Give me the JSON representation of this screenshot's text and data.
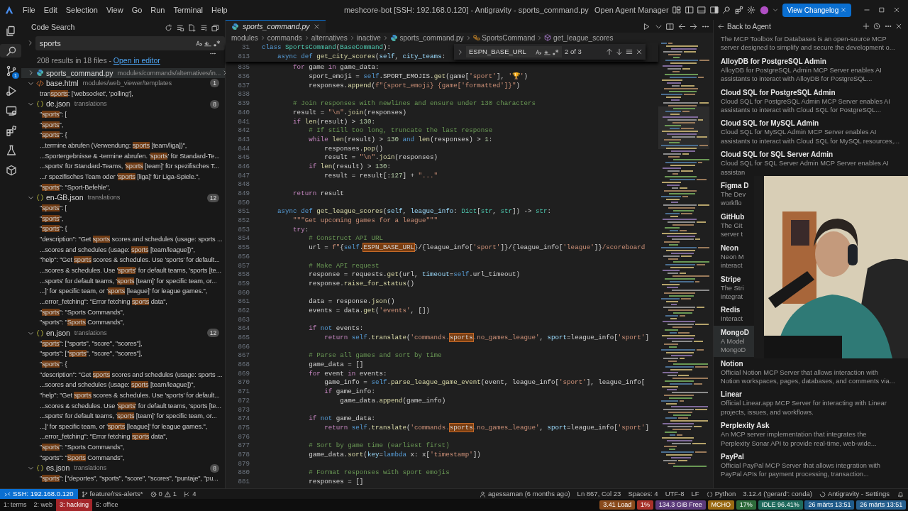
{
  "title_bar": {
    "menu": [
      "File",
      "Edit",
      "Selection",
      "View",
      "Go",
      "Run",
      "Terminal",
      "Help"
    ],
    "title": "meshcore-bot [SSH: 192.168.0.120] - Antigravity - sports_command.py",
    "agent_manager": "Open Agent Manager",
    "changelog_button": "View Changelog"
  },
  "activity_bar": {
    "items": [
      {
        "kind": "files",
        "selected": false
      },
      {
        "kind": "search",
        "selected": true
      },
      {
        "kind": "source-control",
        "selected": false,
        "badge": "1"
      },
      {
        "kind": "run",
        "selected": false
      },
      {
        "kind": "remote",
        "selected": false
      },
      {
        "kind": "extensions",
        "selected": false
      },
      {
        "kind": "testing",
        "selected": false
      },
      {
        "kind": "box",
        "selected": false
      }
    ]
  },
  "sidebar": {
    "title": "Code Search",
    "search": {
      "value": "sports"
    },
    "summary": "208 results in 18 files - ",
    "summary_link": "Open in editor",
    "files": [
      {
        "kind": "python",
        "name": "sports_command.py",
        "path": "modules/commands/alternatives/in...",
        "expanded": false,
        "selected": true
      },
      {
        "kind": "html",
        "name": "base.html",
        "path": "modules/web_viewer/templates",
        "count": "1",
        "expanded": true,
        "selected": false,
        "matches": [
          [
            "tran",
            "sports",
            ": ['websocket', 'polling'],"
          ]
        ]
      },
      {
        "kind": "json",
        "name": "de.json",
        "path": "translations",
        "count": "8",
        "expanded": true,
        "selected": false,
        "matches": [
          [
            "\"",
            "sports",
            "\": ["
          ],
          [
            "\"",
            "sports",
            "\","
          ],
          [
            "\"",
            "sports",
            "\": {"
          ],
          [
            "...termine abrufen (Verwendung: ",
            "sports",
            " [team/liga])\","
          ],
          [
            "...Sportergebnisse & -termine abrufen. '",
            "sports",
            "' für Standard-Te..."
          ],
          [
            "...sports' für Standard-Teams, '",
            "sports",
            " [team]' für spezifisches T..."
          ],
          [
            "...r spezifisches Team oder '",
            "sports",
            " [liga]' für Liga-Spiele.\","
          ],
          [
            "\"",
            "sports",
            "\": \"Sport-Befehle\","
          ]
        ]
      },
      {
        "kind": "json",
        "name": "en-GB.json",
        "path": "translations",
        "count": "12",
        "expanded": true,
        "selected": false,
        "matches": [
          [
            "\"",
            "sports",
            "\": ["
          ],
          [
            "\"",
            "sports",
            "\","
          ],
          [
            "\"",
            "sports",
            "\": {"
          ],
          [
            "\"description\": \"Get ",
            "sports",
            " scores and schedules (usage: sports ..."
          ],
          [
            "...scores and schedules (usage: ",
            "sports",
            " [team/league])\","
          ],
          [
            "\"help\": \"Get ",
            "sports",
            " scores & schedules. Use 'sports' for default..."
          ],
          [
            "...scores & schedules. Use '",
            "sports",
            "' for default teams, 'sports [te..."
          ],
          [
            "...sports' for default teams, '",
            "sports",
            " [team]' for specific team, or..."
          ],
          [
            "...]' for specific team, or '",
            "sports",
            " [league]' for league games.\","
          ],
          [
            "...error_fetching\": \"Error fetching ",
            "sports",
            " data\","
          ],
          [
            "\"",
            "sports",
            "\": \"Sports Commands\","
          ],
          [
            "\"sports\": \"",
            "Sports",
            " Commands\","
          ]
        ]
      },
      {
        "kind": "json",
        "name": "en.json",
        "path": "translations",
        "count": "12",
        "expanded": true,
        "selected": false,
        "matches": [
          [
            "\"",
            "sports",
            "\": [\"sports\", \"score\", \"scores\"],"
          ],
          [
            "\"sports\": [\"",
            "sports",
            "\", \"score\", \"scores\"],"
          ],
          [
            "\"",
            "sports",
            "\": {"
          ],
          [
            "\"description\": \"Get ",
            "sports",
            " scores and schedules (usage: sports ..."
          ],
          [
            "...scores and schedules (usage: ",
            "sports",
            " [team/league])\","
          ],
          [
            "\"help\": \"Get ",
            "sports",
            " scores & schedules. Use 'sports' for default..."
          ],
          [
            "...scores & schedules. Use '",
            "sports",
            "' for default teams, 'sports [te..."
          ],
          [
            "...sports' for default teams, '",
            "sports",
            " [team]' for specific team, or..."
          ],
          [
            "...]' for specific team, or '",
            "sports",
            " [league]' for league games.\","
          ],
          [
            "...error_fetching\": \"Error fetching ",
            "sports",
            " data\","
          ],
          [
            "\"",
            "sports",
            "\": \"Sports Commands\","
          ],
          [
            "\"sports\": \"",
            "Sports",
            " Commands\","
          ]
        ]
      },
      {
        "kind": "json",
        "name": "es.json",
        "path": "translations",
        "count": "8",
        "expanded": true,
        "selected": false,
        "matches": [
          [
            "\"",
            "sports",
            "\": [\"deportes\", \"sports\", \"score\", \"scores\", \"puntaje\", \"pu..."
          ]
        ]
      }
    ]
  },
  "editor": {
    "tab": {
      "label": "sports_command.py",
      "selected": true
    },
    "breadcrumb": [
      {
        "kind": "folder",
        "label": "modules"
      },
      {
        "kind": "folder",
        "label": "commands"
      },
      {
        "kind": "folder",
        "label": "alternatives"
      },
      {
        "kind": "folder",
        "label": "inactive"
      },
      {
        "kind": "file",
        "label": "sports_command.py"
      },
      {
        "kind": "class",
        "label": "SportsCommand"
      },
      {
        "kind": "method",
        "label": "get_league_scores"
      }
    ],
    "find": {
      "value": "ESPN_BASE_URL",
      "result": "2 of 3"
    },
    "sticky": [
      {
        "n": "31",
        "code": [
          {
            "kind": "k",
            "text": "class"
          },
          {
            "kind": "t",
            "text": " SportsCommand"
          },
          {
            "kind": "p",
            "text": "("
          },
          {
            "kind": "t",
            "text": "BaseCommand"
          },
          {
            "kind": "p",
            "text": "):"
          }
        ]
      },
      {
        "n": "813",
        "code": [
          {
            "kind": "k",
            "text": "    async"
          },
          {
            "kind": "k",
            "text": " def"
          },
          {
            "kind": "f",
            "text": " get_city_scores"
          },
          {
            "kind": "p",
            "text": "("
          },
          {
            "kind": "v",
            "text": "self"
          },
          {
            "kind": "p",
            "text": ", "
          },
          {
            "kind": "v",
            "text": "city_teams"
          },
          {
            "kind": "p",
            "text": ":"
          }
        ]
      }
    ],
    "lines": [
      {
        "n": "835",
        "code": [
          {
            "kind": "c",
            "text": "        for"
          },
          {
            "kind": "p",
            "text": " game "
          },
          {
            "kind": "c",
            "text": "in"
          },
          {
            "kind": "p",
            "text": " game_data:"
          }
        ]
      },
      {
        "n": "836",
        "code": [
          {
            "kind": "p",
            "text": "            sport_emoji = "
          },
          {
            "kind": "k",
            "text": "self"
          },
          {
            "kind": "p",
            "text": ".SPORT_EMOJIS."
          },
          {
            "kind": "f",
            "text": "get"
          },
          {
            "kind": "p",
            "text": "(game["
          },
          {
            "kind": "s",
            "text": "'sport'"
          },
          {
            "kind": "p",
            "text": "], "
          },
          {
            "kind": "s",
            "text": "'🏆'"
          },
          {
            "kind": "p",
            "text": ")"
          }
        ]
      },
      {
        "n": "837",
        "code": [
          {
            "kind": "p",
            "text": "            responses."
          },
          {
            "kind": "f",
            "text": "append"
          },
          {
            "kind": "p",
            "text": "("
          },
          {
            "kind": "s",
            "text": "f\"{sport_emoji} {game['formatted']}\""
          },
          {
            "kind": "p",
            "text": ")"
          }
        ]
      },
      {
        "n": "838"
      },
      {
        "n": "839",
        "code": [
          {
            "kind": "m",
            "text": "        # Join responses with newlines and ensure under 130 characters"
          }
        ]
      },
      {
        "n": "840",
        "code": [
          {
            "kind": "p",
            "text": "        result = "
          },
          {
            "kind": "s",
            "text": "\"\\n\""
          },
          {
            "kind": "p",
            "text": "."
          },
          {
            "kind": "f",
            "text": "join"
          },
          {
            "kind": "p",
            "text": "(responses)"
          }
        ]
      },
      {
        "n": "841",
        "code": [
          {
            "kind": "c",
            "text": "        if"
          },
          {
            "kind": "f",
            "text": " len"
          },
          {
            "kind": "p",
            "text": "(result) > "
          },
          {
            "kind": "n",
            "text": "130"
          },
          {
            "kind": "p",
            "text": ":"
          }
        ]
      },
      {
        "n": "842",
        "code": [
          {
            "kind": "m",
            "text": "            # If still too long, truncate the last response"
          }
        ]
      },
      {
        "n": "843",
        "code": [
          {
            "kind": "c",
            "text": "            while"
          },
          {
            "kind": "f",
            "text": " len"
          },
          {
            "kind": "p",
            "text": "(result) > "
          },
          {
            "kind": "n",
            "text": "130"
          },
          {
            "kind": "k",
            "text": " and"
          },
          {
            "kind": "f",
            "text": " len"
          },
          {
            "kind": "p",
            "text": "(responses) > "
          },
          {
            "kind": "n",
            "text": "1"
          },
          {
            "kind": "p",
            "text": ":"
          }
        ]
      },
      {
        "n": "844",
        "code": [
          {
            "kind": "p",
            "text": "                responses."
          },
          {
            "kind": "f",
            "text": "pop"
          },
          {
            "kind": "p",
            "text": "()"
          }
        ]
      },
      {
        "n": "845",
        "code": [
          {
            "kind": "p",
            "text": "                result = "
          },
          {
            "kind": "s",
            "text": "\"\\n\""
          },
          {
            "kind": "p",
            "text": "."
          },
          {
            "kind": "f",
            "text": "join"
          },
          {
            "kind": "p",
            "text": "(responses)"
          }
        ]
      },
      {
        "n": "846",
        "code": [
          {
            "kind": "c",
            "text": "            if"
          },
          {
            "kind": "f",
            "text": " len"
          },
          {
            "kind": "p",
            "text": "(result) > "
          },
          {
            "kind": "n",
            "text": "130"
          },
          {
            "kind": "p",
            "text": ":"
          }
        ]
      },
      {
        "n": "847",
        "code": [
          {
            "kind": "p",
            "text": "                result = result[:"
          },
          {
            "kind": "n",
            "text": "127"
          },
          {
            "kind": "p",
            "text": "] + "
          },
          {
            "kind": "s",
            "text": "\"...\""
          }
        ]
      },
      {
        "n": "848"
      },
      {
        "n": "849",
        "code": [
          {
            "kind": "c",
            "text": "        return"
          },
          {
            "kind": "p",
            "text": " result"
          }
        ]
      },
      {
        "n": "850"
      },
      {
        "n": "851",
        "code": [
          {
            "kind": "k",
            "text": "    async"
          },
          {
            "kind": "k",
            "text": " def"
          },
          {
            "kind": "f",
            "text": " get_league_scores"
          },
          {
            "kind": "p",
            "text": "("
          },
          {
            "kind": "v",
            "text": "self"
          },
          {
            "kind": "p",
            "text": ", "
          },
          {
            "kind": "v",
            "text": "league_info"
          },
          {
            "kind": "p",
            "text": ": "
          },
          {
            "kind": "t",
            "text": "Dict"
          },
          {
            "kind": "p",
            "text": "["
          },
          {
            "kind": "t",
            "text": "str"
          },
          {
            "kind": "p",
            "text": ", "
          },
          {
            "kind": "t",
            "text": "str"
          },
          {
            "kind": "p",
            "text": "]) -> "
          },
          {
            "kind": "t",
            "text": "str"
          },
          {
            "kind": "p",
            "text": ":"
          }
        ]
      },
      {
        "n": "852",
        "code": [
          {
            "kind": "s",
            "text": "        \"\"\"Get upcoming games for a league\"\"\""
          }
        ]
      },
      {
        "n": "853",
        "code": [
          {
            "kind": "c",
            "text": "        try"
          },
          {
            "kind": "p",
            "text": ":"
          }
        ]
      },
      {
        "n": "854",
        "code": [
          {
            "kind": "m",
            "text": "            # Construct API URL"
          }
        ]
      },
      {
        "n": "855",
        "code": [
          {
            "kind": "p",
            "text": "            url = "
          },
          {
            "kind": "s",
            "text": "f\""
          },
          {
            "kind": "p",
            "text": "{"
          },
          {
            "kind": "k",
            "text": "self"
          },
          {
            "kind": "p",
            "text": "."
          },
          {
            "kind": "h",
            "text": "ESPN_BASE_URL"
          },
          {
            "kind": "p",
            "text": "}/{league_info["
          },
          {
            "kind": "s",
            "text": "'sport'"
          },
          {
            "kind": "p",
            "text": "]}/{league_info["
          },
          {
            "kind": "s",
            "text": "'league'"
          },
          {
            "kind": "p",
            "text": "]}"
          },
          {
            "kind": "s",
            "text": "/scoreboard"
          }
        ]
      },
      {
        "n": "856"
      },
      {
        "n": "857",
        "code": [
          {
            "kind": "m",
            "text": "            # Make API request"
          }
        ]
      },
      {
        "n": "858",
        "code": [
          {
            "kind": "p",
            "text": "            response = requests."
          },
          {
            "kind": "f",
            "text": "get"
          },
          {
            "kind": "p",
            "text": "(url, "
          },
          {
            "kind": "v",
            "text": "timeout"
          },
          {
            "kind": "p",
            "text": "="
          },
          {
            "kind": "k",
            "text": "self"
          },
          {
            "kind": "p",
            "text": ".url_timeout)"
          }
        ]
      },
      {
        "n": "859",
        "code": [
          {
            "kind": "p",
            "text": "            response."
          },
          {
            "kind": "f",
            "text": "raise_for_status"
          },
          {
            "kind": "p",
            "text": "()"
          }
        ]
      },
      {
        "n": "860"
      },
      {
        "n": "861",
        "code": [
          {
            "kind": "p",
            "text": "            data = response."
          },
          {
            "kind": "f",
            "text": "json"
          },
          {
            "kind": "p",
            "text": "()"
          }
        ]
      },
      {
        "n": "862",
        "code": [
          {
            "kind": "p",
            "text": "            events = data."
          },
          {
            "kind": "f",
            "text": "get"
          },
          {
            "kind": "p",
            "text": "("
          },
          {
            "kind": "s",
            "text": "'events'"
          },
          {
            "kind": "p",
            "text": ", [])"
          }
        ]
      },
      {
        "n": "863"
      },
      {
        "n": "864",
        "code": [
          {
            "kind": "c",
            "text": "            if"
          },
          {
            "kind": "k",
            "text": " not"
          },
          {
            "kind": "p",
            "text": " events:"
          }
        ]
      },
      {
        "n": "865",
        "code": [
          {
            "kind": "c",
            "text": "                return"
          },
          {
            "kind": "k",
            "text": " self"
          },
          {
            "kind": "p",
            "text": "."
          },
          {
            "kind": "f",
            "text": "translate"
          },
          {
            "kind": "p",
            "text": "("
          },
          {
            "kind": "s",
            "text": "'commands."
          },
          {
            "kind": "h",
            "text": "sports"
          },
          {
            "kind": "s",
            "text": ".no_games_league'"
          },
          {
            "kind": "p",
            "text": ", "
          },
          {
            "kind": "v",
            "text": "sport"
          },
          {
            "kind": "p",
            "text": "=league_info["
          },
          {
            "kind": "s",
            "text": "'sport'"
          },
          {
            "kind": "p",
            "text": "]"
          }
        ]
      },
      {
        "n": "866"
      },
      {
        "n": "867",
        "code": [
          {
            "kind": "m",
            "text": "            # Parse all games and sort by time"
          }
        ]
      },
      {
        "n": "868",
        "code": [
          {
            "kind": "p",
            "text": "            game_data = []"
          }
        ]
      },
      {
        "n": "869",
        "code": [
          {
            "kind": "c",
            "text": "            for"
          },
          {
            "kind": "p",
            "text": " event "
          },
          {
            "kind": "c",
            "text": "in"
          },
          {
            "kind": "p",
            "text": " events:"
          }
        ]
      },
      {
        "n": "870",
        "code": [
          {
            "kind": "p",
            "text": "                game_info = "
          },
          {
            "kind": "k",
            "text": "self"
          },
          {
            "kind": "p",
            "text": "."
          },
          {
            "kind": "f",
            "text": "parse_league_game_event"
          },
          {
            "kind": "p",
            "text": "(event, league_info["
          },
          {
            "kind": "s",
            "text": "'sport'"
          },
          {
            "kind": "p",
            "text": "], league_info["
          }
        ]
      },
      {
        "n": "871",
        "code": [
          {
            "kind": "c",
            "text": "                if"
          },
          {
            "kind": "p",
            "text": " game_info:"
          }
        ]
      },
      {
        "n": "872",
        "code": [
          {
            "kind": "p",
            "text": "                    game_data."
          },
          {
            "kind": "f",
            "text": "append"
          },
          {
            "kind": "p",
            "text": "(game_info)"
          }
        ]
      },
      {
        "n": "873"
      },
      {
        "n": "874",
        "code": [
          {
            "kind": "c",
            "text": "            if"
          },
          {
            "kind": "k",
            "text": " not"
          },
          {
            "kind": "p",
            "text": " game_data:"
          }
        ]
      },
      {
        "n": "875",
        "code": [
          {
            "kind": "c",
            "text": "                return"
          },
          {
            "kind": "k",
            "text": " self"
          },
          {
            "kind": "p",
            "text": "."
          },
          {
            "kind": "f",
            "text": "translate"
          },
          {
            "kind": "p",
            "text": "("
          },
          {
            "kind": "s",
            "text": "'commands."
          },
          {
            "kind": "h",
            "text": "sports"
          },
          {
            "kind": "s",
            "text": ".no_games_league'"
          },
          {
            "kind": "p",
            "text": ", "
          },
          {
            "kind": "v",
            "text": "sport"
          },
          {
            "kind": "p",
            "text": "=league_info["
          },
          {
            "kind": "s",
            "text": "'sport'"
          },
          {
            "kind": "p",
            "text": "]"
          }
        ]
      },
      {
        "n": "876"
      },
      {
        "n": "877",
        "code": [
          {
            "kind": "m",
            "text": "            # Sort by game time (earliest first)"
          }
        ]
      },
      {
        "n": "878",
        "code": [
          {
            "kind": "p",
            "text": "            game_data."
          },
          {
            "kind": "f",
            "text": "sort"
          },
          {
            "kind": "p",
            "text": "("
          },
          {
            "kind": "v",
            "text": "key"
          },
          {
            "kind": "p",
            "text": "="
          },
          {
            "kind": "k",
            "text": "lambda"
          },
          {
            "kind": "p",
            "text": " x: x["
          },
          {
            "kind": "s",
            "text": "'timestamp'"
          },
          {
            "kind": "p",
            "text": "])"
          }
        ]
      },
      {
        "n": "879"
      },
      {
        "n": "880",
        "code": [
          {
            "kind": "m",
            "text": "            # Format responses with sport emojis"
          }
        ]
      },
      {
        "n": "881",
        "code": [
          {
            "kind": "p",
            "text": "            responses = []"
          }
        ]
      }
    ]
  },
  "agent_panel": {
    "back": "Back to Agent",
    "intro": [
      "The MCP Toolbox for Databases is an open-source MCP",
      "server designed to simplify and secure the development o..."
    ],
    "servers": [
      {
        "name": "AlloyDB for PostgreSQL Admin",
        "description": [
          "AlloyDB for PostgreSQL Admin MCP Server enables AI",
          "assistants to interact with AlloyDB for PostgreSQL..."
        ],
        "highlighted": false
      },
      {
        "name": "Cloud SQL for PostgreSQL Admin",
        "description": [
          "Cloud SQL for PostgreSQL Admin MCP Server enables AI",
          "assistants to interact with Cloud SQL for PostgreSQL..."
        ],
        "highlighted": false
      },
      {
        "name": "Cloud SQL for MySQL Admin",
        "description": [
          "Cloud SQL for MySQL Admin MCP Server enables AI",
          "assistants to interact with Cloud SQL for MySQL resources,..."
        ],
        "highlighted": false
      },
      {
        "name": "Cloud SQL for SQL Server Admin",
        "description": [
          "Cloud SQL for SQL Server Admin MCP Server enables AI",
          "assistan"
        ],
        "highlighted": false
      },
      {
        "name": "Figma D",
        "description": [
          "The Dev",
          "workflo"
        ],
        "highlighted": false
      },
      {
        "name": "GitHub",
        "description": [
          "The Git",
          "server t"
        ],
        "highlighted": false
      },
      {
        "name": "Neon",
        "description": [
          "Neon M",
          "interact"
        ],
        "highlighted": false
      },
      {
        "name": "Stripe",
        "description": [
          "The Stri",
          "integrat"
        ],
        "highlighted": false
      },
      {
        "name": "Redis",
        "description": [
          "Interact"
        ],
        "highlighted": false
      },
      {
        "name": "MongoD",
        "description": [
          "A Model",
          "MongoD"
        ],
        "highlighted": true
      },
      {
        "name": "Notion",
        "description": [
          "Official Notion MCP Server that allows interaction with",
          "Notion workspaces, pages, databases, and comments via..."
        ],
        "highlighted": false
      },
      {
        "name": "Linear",
        "description": [
          "Official Linear.app MCP Server for interacting with Linear",
          "projects, issues, and workflows."
        ],
        "highlighted": false
      },
      {
        "name": "Perplexity Ask",
        "description": [
          "An MCP server implementation that integrates the",
          "Perplexity Sonar API to provide real-time, web-wide..."
        ],
        "highlighted": false
      },
      {
        "name": "PayPal",
        "description": [
          "Official PayPal MCP Server that allows integration with",
          "PayPal APIs for payment processing, transaction..."
        ],
        "highlighted": false
      }
    ]
  },
  "status_bar": {
    "remote": "SSH: 192.168.0.120",
    "branch": "feature/rss-alerts*",
    "errors": "0",
    "warnings": "1",
    "ports": "4",
    "blame": "agessaman (6 months ago)",
    "position": "Ln 867, Col 23",
    "indent": "Spaces: 4",
    "encoding": "UTF-8",
    "eol": "LF",
    "language": "Python",
    "interpreter": "3.12.4 ('gerard': conda)",
    "settings": "Antigravity - Settings"
  },
  "taskbar": {
    "workspaces": [
      {
        "label": "1: terms",
        "selected": false
      },
      {
        "label": "2: web",
        "selected": false
      },
      {
        "label": "3: hacking",
        "selected": true
      },
      {
        "label": "5: office",
        "selected": false
      }
    ],
    "indicators": [
      {
        "text": "3.41 Load",
        "color": "#8a4b1c"
      },
      {
        "text": "1%",
        "color": "#a8322a"
      },
      {
        "text": "134.3 GiB Free",
        "color": "#5b3a7a"
      },
      {
        "text": "MCHO",
        "color": "#9a6a12"
      },
      {
        "text": "17%",
        "color": "#2e6b3a"
      },
      {
        "text": "IDLE 96.41%",
        "color": "#1f6a5c"
      },
      {
        "text": "26 märts 13:51",
        "color": "#1f5a8a"
      },
      {
        "text": "26 märts 13:51",
        "color": "#27608f"
      }
    ]
  }
}
